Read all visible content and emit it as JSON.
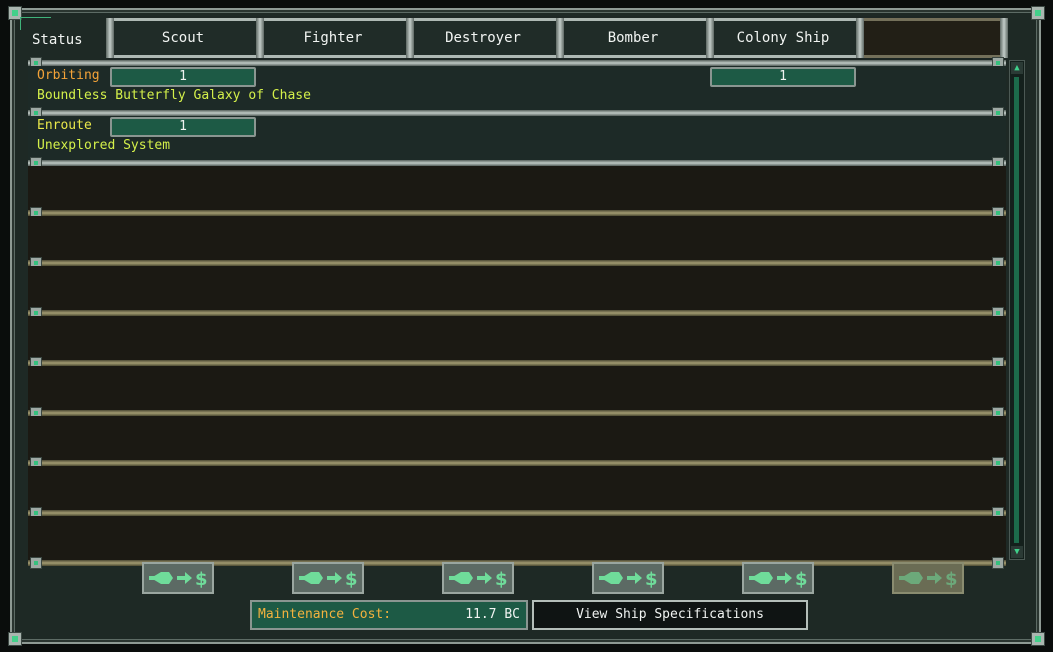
{
  "header": {
    "status_label": "Status",
    "columns": [
      "Scout",
      "Fighter",
      "Destroyer",
      "Bomber",
      "Colony Ship",
      ""
    ]
  },
  "rows": [
    {
      "status": "Orbiting",
      "status_color": "#f4a338",
      "location": "Boundless Butterfly Galaxy of Chase",
      "counts": [
        "1",
        "",
        "",
        "",
        "1",
        ""
      ]
    },
    {
      "status": "Enroute",
      "status_color": "#e9e84a",
      "location": "Unexplored System",
      "counts": [
        "1",
        "",
        "",
        "",
        "",
        ""
      ]
    }
  ],
  "empty_rows": 8,
  "sell_buttons": [
    {
      "icon": "ship-to-money-icon",
      "enabled": true
    },
    {
      "icon": "ship-to-money-icon",
      "enabled": true
    },
    {
      "icon": "ship-to-money-icon",
      "enabled": true
    },
    {
      "icon": "ship-to-money-icon",
      "enabled": true
    },
    {
      "icon": "ship-to-money-icon",
      "enabled": true
    },
    {
      "icon": "ship-to-money-icon",
      "enabled": false
    }
  ],
  "footer": {
    "maintenance_label": "Maintenance Cost:",
    "maintenance_value": "11.7 BC",
    "view_specs_label": "View Ship Specifications"
  },
  "colors": {
    "accent_green": "#43d08a",
    "count_fill": "#1d5a45",
    "location_text": "#d4f04a",
    "maintenance_label": "#f4b23e"
  }
}
